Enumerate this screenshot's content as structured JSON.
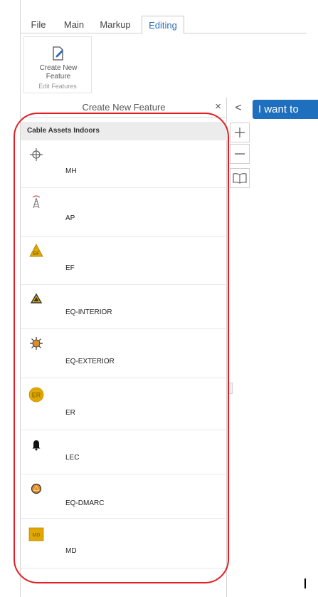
{
  "tabs": [
    {
      "label": "File",
      "active": false
    },
    {
      "label": "Main",
      "active": false
    },
    {
      "label": "Markup",
      "active": false
    },
    {
      "label": "Editing",
      "active": true
    }
  ],
  "ribbon": {
    "create_button_label_1": "Create New",
    "create_button_label_2": "Feature",
    "group_label": "Edit Features"
  },
  "panel": {
    "title": "Create New Feature",
    "close_symbol": "×",
    "category": "Cable Assets Indoors",
    "items": [
      {
        "label": "MH",
        "icon": "crosshair-icon"
      },
      {
        "label": "AP",
        "icon": "antenna-tower-icon"
      },
      {
        "label": "EF",
        "icon": "ef-triangle-icon"
      },
      {
        "label": "EQ-INTERIOR",
        "icon": "warning-triangle-icon"
      },
      {
        "label": "EQ-EXTERIOR",
        "icon": "sun-burst-icon"
      },
      {
        "label": "ER",
        "icon": "er-circle-icon"
      },
      {
        "label": "LEC",
        "icon": "bell-icon"
      },
      {
        "label": "EQ-DMARC",
        "icon": "dmarc-circle-icon"
      },
      {
        "label": "MD",
        "icon": "md-square-icon"
      }
    ],
    "ef_icon_text": "EF",
    "er_icon_text": "ER",
    "md_icon_text": "MD"
  },
  "map": {
    "collapse_symbol": "<",
    "i_want_to": "I want to"
  },
  "colors": {
    "accent": "#2a6db5",
    "button_blue": "#1f6fbf",
    "highlight_ring": "#e31e24",
    "icon_gold": "#e0a800"
  }
}
